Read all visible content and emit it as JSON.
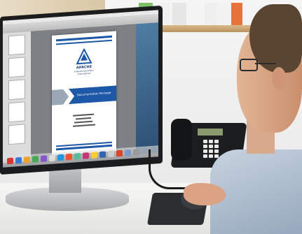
{
  "scene": {
    "description_kind": "photo",
    "subject": "office-workstation"
  },
  "document": {
    "org_name": "APACHE",
    "org_subtitle_1": "FOREIGN EQUIPMENT",
    "org_subtitle_2": "CORPORATION",
    "title": "Documentation Package"
  },
  "colors": {
    "doc_blue": "#1d57a8",
    "doc_arrow": "#1d57a8",
    "trackball": "#d11a1a",
    "shirt": "#b3c1d1",
    "desk": "#eeeeec"
  }
}
